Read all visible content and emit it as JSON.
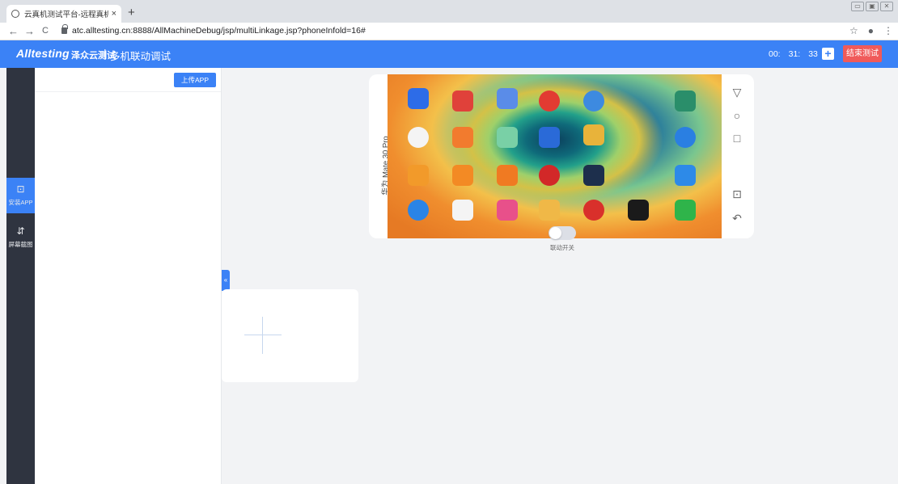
{
  "browser": {
    "tab_title": "云真机测试平台-远程真机测试-Ｅ",
    "tab_close": "×",
    "new_tab": "+",
    "back": "←",
    "forward": "→",
    "reload": "C",
    "url": "atc.alltesting.cn:8888/AllMachineDebug/jsp/multiLinkage.jsp?phoneInfold=16#",
    "star": "☆",
    "account": "●",
    "menu": "⋮",
    "win_min": "▭",
    "win_max": "▣",
    "win_close": "✕"
  },
  "header": {
    "logo": "Alltesting",
    "logo_cn": "泽众云测试",
    "separator": "|",
    "title": "多机联动调试",
    "timer": {
      "h": "00:",
      "m": "31:",
      "s": "33"
    },
    "add_label": "+",
    "end_button": "结束测试"
  },
  "sidebar": {
    "items": [
      {
        "label": "安装APP",
        "icon": "install-icon",
        "glyph": "⊡",
        "active": true
      },
      {
        "label": "屏幕截图",
        "icon": "screenshot-icon",
        "glyph": "⇵",
        "active": false
      }
    ]
  },
  "panel": {
    "upload_button": "上传APP",
    "collapse": "«"
  },
  "device": {
    "name": "华为 Mate 30 Pro",
    "controls": {
      "back": "▽",
      "home": "○",
      "recent": "□",
      "screenshot": "⊡",
      "rotate": "↶"
    },
    "toggle_label": "联动开关",
    "toggle_on": false
  },
  "colors": {
    "accent": "#3b82f6",
    "danger": "#f05a5a",
    "sidebar": "#2f3440"
  }
}
